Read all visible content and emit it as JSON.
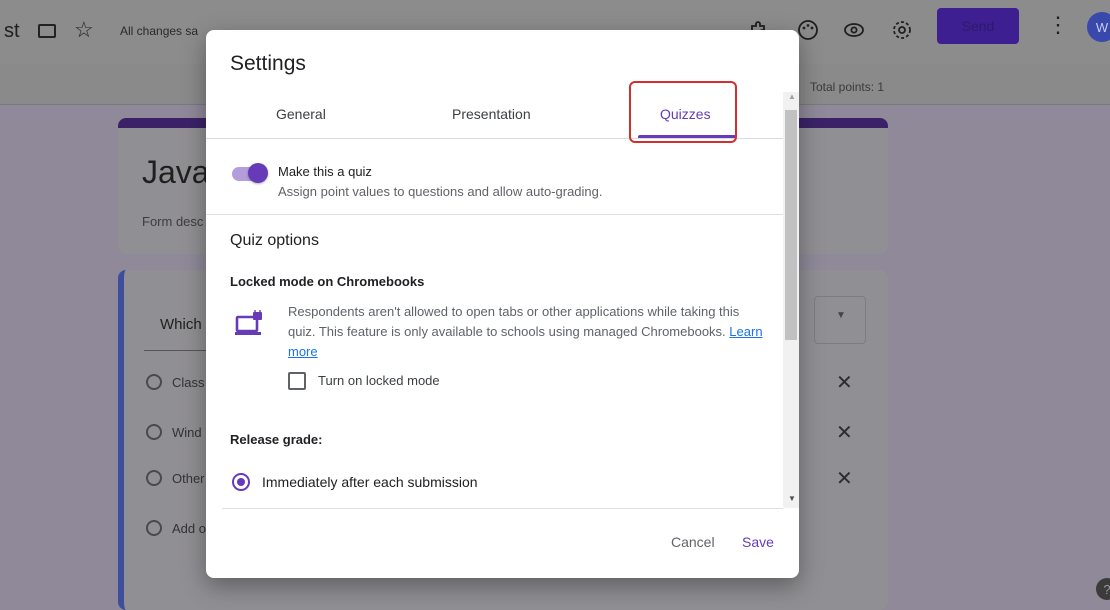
{
  "topbar": {
    "doc_title": "st",
    "save_status": "All changes sa",
    "send_label": "Send",
    "avatar_initial": "W",
    "icons": [
      "folder-icon",
      "star-icon",
      "puzzle-icon",
      "palette-icon",
      "eye-icon",
      "gear-icon",
      "more-vert-icon"
    ]
  },
  "subbar": {
    "total_points": "Total points: 1"
  },
  "background_form": {
    "title": "Java",
    "description": "Form desc",
    "question": "Which",
    "options": [
      "Class",
      "Wind",
      "Other",
      "Add o"
    ]
  },
  "settings_dialog": {
    "title": "Settings",
    "tabs": [
      {
        "label": "General",
        "selected": false
      },
      {
        "label": "Presentation",
        "selected": false
      },
      {
        "label": "Quizzes",
        "selected": true
      }
    ],
    "make_quiz": {
      "label": "Make this a quiz",
      "description": "Assign point values to questions and allow auto-grading.",
      "enabled": true
    },
    "quiz_options": {
      "heading": "Quiz options",
      "locked_mode": {
        "heading": "Locked mode on Chromebooks",
        "description": "Respondents aren't allowed to open tabs or other applications while taking this quiz. This feature is only available to schools using managed Chromebooks.",
        "learn_more": "Learn more",
        "checkbox_label": "Turn on locked mode",
        "checked": false
      },
      "release_grade": {
        "heading": "Release grade:",
        "option": "Immediately after each submission",
        "selected": true
      }
    },
    "buttons": {
      "cancel": "Cancel",
      "save": "Save"
    }
  },
  "colors": {
    "accent": "#673ab7",
    "highlight_border": "#d32f2f",
    "link": "#1a73e8"
  }
}
